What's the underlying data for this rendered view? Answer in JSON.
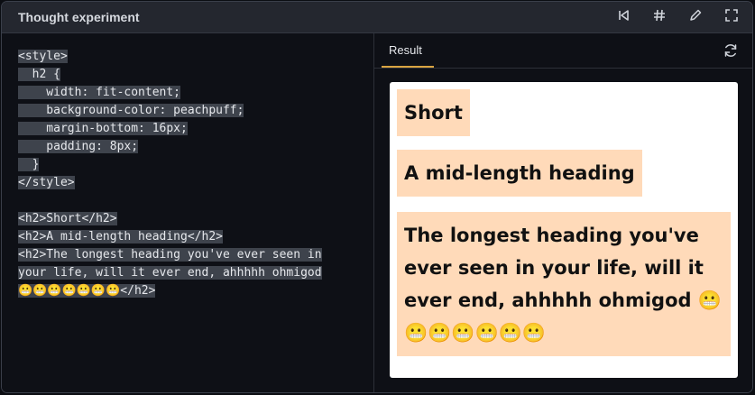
{
  "window": {
    "title": "Thought experiment"
  },
  "toolbar": {
    "icons": [
      "step-back-icon",
      "hash-icon",
      "pencil-icon",
      "fullscreen-icon"
    ]
  },
  "editor": {
    "lines": [
      "<style>",
      "  h2 {",
      "    width: fit-content;",
      "    background-color: peachpuff;",
      "    margin-bottom: 16px;",
      "    padding: 8px;",
      "  }",
      "</style>",
      "",
      "<h2>Short</h2>",
      "<h2>A mid-length heading</h2>",
      "<h2>The longest heading you've ever seen in",
      "your life, will it ever end, ahhhhh ohmigod",
      "😬😬😬😬😬😬😬</h2>"
    ]
  },
  "result": {
    "tab_label": "Result",
    "headings": {
      "short": "Short",
      "mid": "A mid-length heading",
      "long": "The longest heading you've ever seen in your life, will it ever end, ahhhhh ohmigod 😬😬😬😬😬😬😬"
    }
  },
  "colors": {
    "accent": "#d9a441",
    "heading_bg": "#ffdab9",
    "titlebar": "#24272f"
  }
}
